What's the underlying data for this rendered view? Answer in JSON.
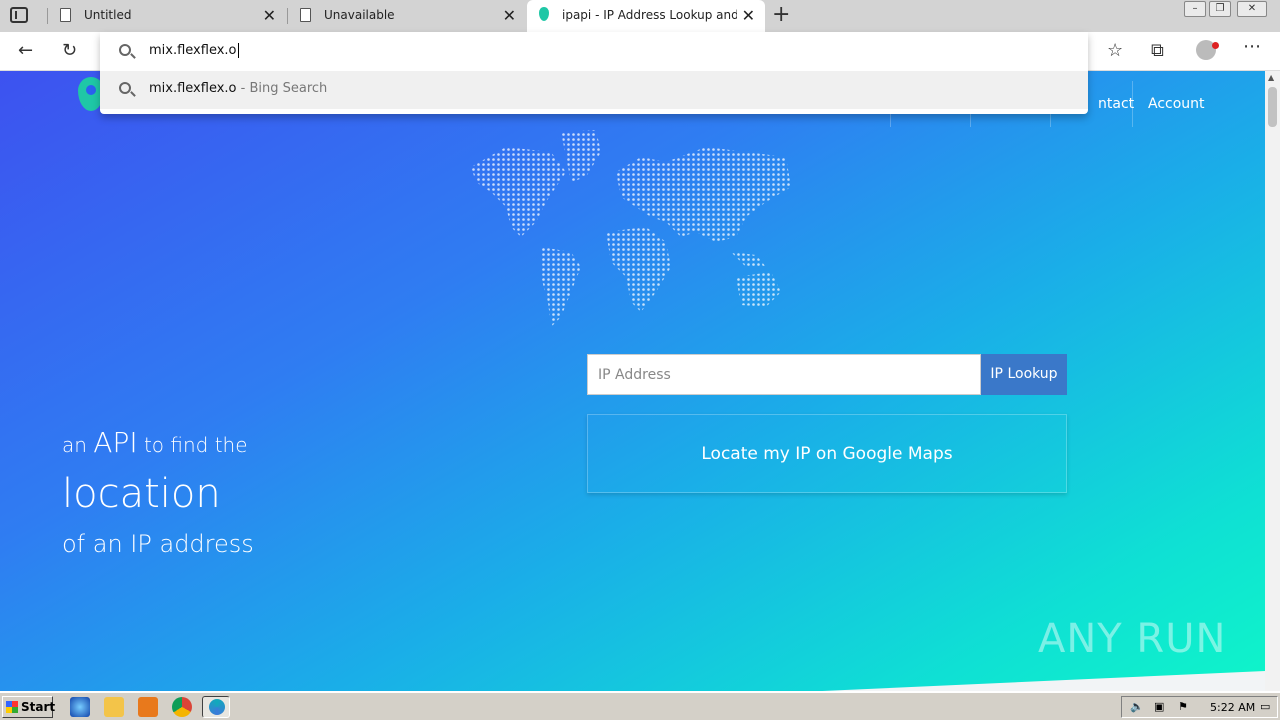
{
  "browser": {
    "tabs": [
      {
        "title": "Untitled",
        "active": false
      },
      {
        "title": "Unavailable",
        "active": false
      },
      {
        "title": "ipapi - IP Address Lookup and Ge",
        "active": true
      }
    ],
    "address_input": "mix.flexflex.o",
    "suggestions": [
      {
        "text": "mix.flexflex.o",
        "suffix": " - Bing Search"
      }
    ]
  },
  "page": {
    "nav": {
      "contact": "ntact",
      "account": "Account"
    },
    "tagline": {
      "pre": "an",
      "api": "API",
      "post": "to find the",
      "big": "location",
      "line3": "of an IP address"
    },
    "ip_placeholder": "IP Address",
    "ip_button": "IP Lookup",
    "locate_button": "Locate my IP on Google Maps",
    "watermark": "ANY RUN"
  },
  "taskbar": {
    "start": "Start",
    "clock": "5:22 AM"
  },
  "colors": {
    "accent_button": "#3a78c9",
    "gradient_start": "#3d52f0",
    "gradient_end": "#0ff5c9"
  }
}
